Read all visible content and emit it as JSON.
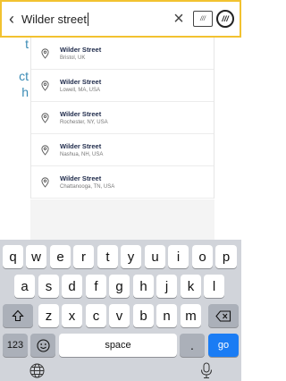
{
  "search": {
    "value": "Wilder street"
  },
  "background_text": [
    "t",
    "",
    "ct",
    "h"
  ],
  "suggestions": [
    {
      "name": "Wilder Street",
      "location": "Bristol, UK"
    },
    {
      "name": "Wilder Street",
      "location": "Lowell, MA, USA"
    },
    {
      "name": "Wilder Street",
      "location": "Rochester, NY, USA"
    },
    {
      "name": "Wilder Street",
      "location": "Nashua, NH, USA"
    },
    {
      "name": "Wilder Street",
      "location": "Chattanooga, TN, USA"
    }
  ],
  "keyboard": {
    "row1": [
      "q",
      "w",
      "e",
      "r",
      "t",
      "y",
      "u",
      "i",
      "o",
      "p"
    ],
    "row2": [
      "a",
      "s",
      "d",
      "f",
      "g",
      "h",
      "j",
      "k",
      "l"
    ],
    "row3": [
      "z",
      "x",
      "c",
      "v",
      "b",
      "n",
      "m"
    ],
    "numbers_label": "123",
    "space_label": "space",
    "period_label": ".",
    "go_label": "go"
  },
  "colors": {
    "search_border": "#f2c230",
    "go_key": "#1a7cf4",
    "title_text": "#1e2a4a"
  }
}
